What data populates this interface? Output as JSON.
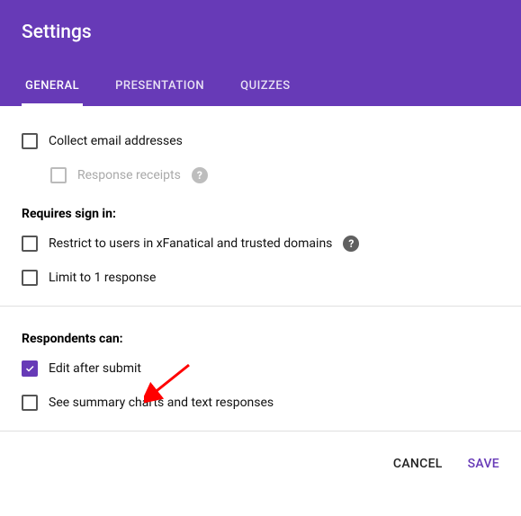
{
  "header": {
    "title": "Settings",
    "tabs": [
      "GENERAL",
      "PRESENTATION",
      "QUIZZES"
    ],
    "active_tab": 0
  },
  "options": {
    "collect_email": "Collect email addresses",
    "response_receipts": "Response receipts",
    "requires_signin_label": "Requires sign in:",
    "restrict": "Restrict to users in xFanatical and trusted domains",
    "limit_one": "Limit to 1 response",
    "respondents_label": "Respondents can:",
    "edit_after_submit": "Edit after submit",
    "see_summary": "See summary charts and text responses"
  },
  "help": {
    "glyph": "?"
  },
  "footer": {
    "cancel": "CANCEL",
    "save": "SAVE"
  }
}
